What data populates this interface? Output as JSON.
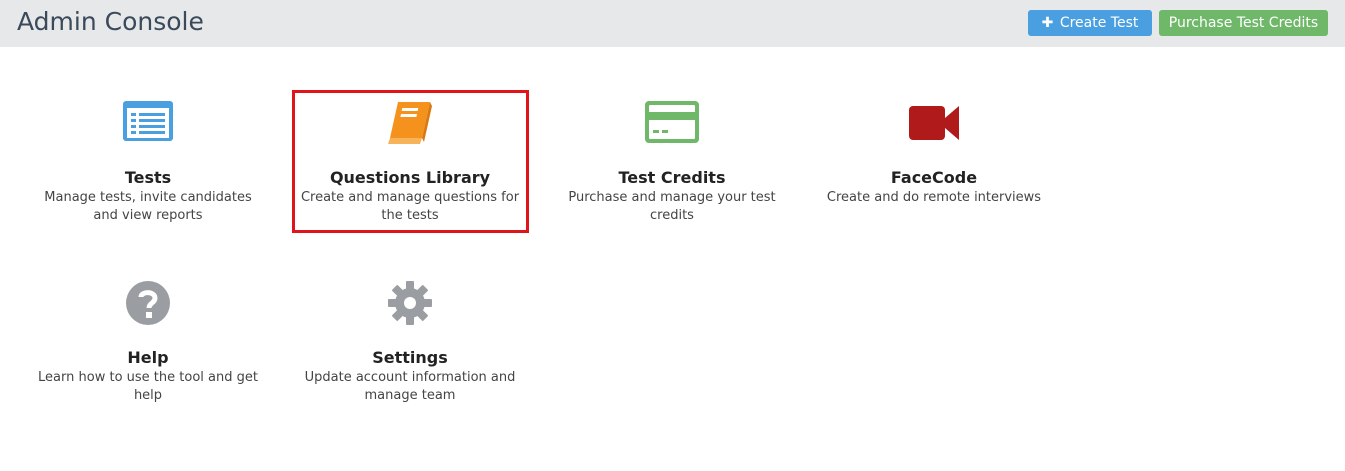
{
  "header": {
    "title": "Admin Console",
    "create_test_label": "Create Test",
    "purchase_label": "Purchase Test Credits"
  },
  "tiles": [
    {
      "name": "Tests",
      "desc": "Manage tests, invite candidates and view reports",
      "icon": "list-icon",
      "color": "#4a9fe0"
    },
    {
      "name": "Questions Library",
      "desc": "Create and manage questions for the tests",
      "icon": "book-icon",
      "color": "#f5921e"
    },
    {
      "name": "Test Credits",
      "desc": "Purchase and manage your test credits",
      "icon": "credit-card-icon",
      "color": "#6fb86a"
    },
    {
      "name": "FaceCode",
      "desc": "Create and do remote interviews",
      "icon": "video-camera-icon",
      "color": "#b01a1a"
    },
    {
      "name": "Help",
      "desc": "Learn how to use the tool and get help",
      "icon": "question-icon",
      "color": "#9a9da1"
    },
    {
      "name": "Settings",
      "desc": "Update account information and manage team",
      "icon": "gear-icon",
      "color": "#9a9da1"
    }
  ],
  "colors": {
    "header_bg": "#e7e8ea",
    "create_button": "#4a9fe0",
    "purchase_button": "#6fb86a",
    "highlight": "#e0141b"
  }
}
